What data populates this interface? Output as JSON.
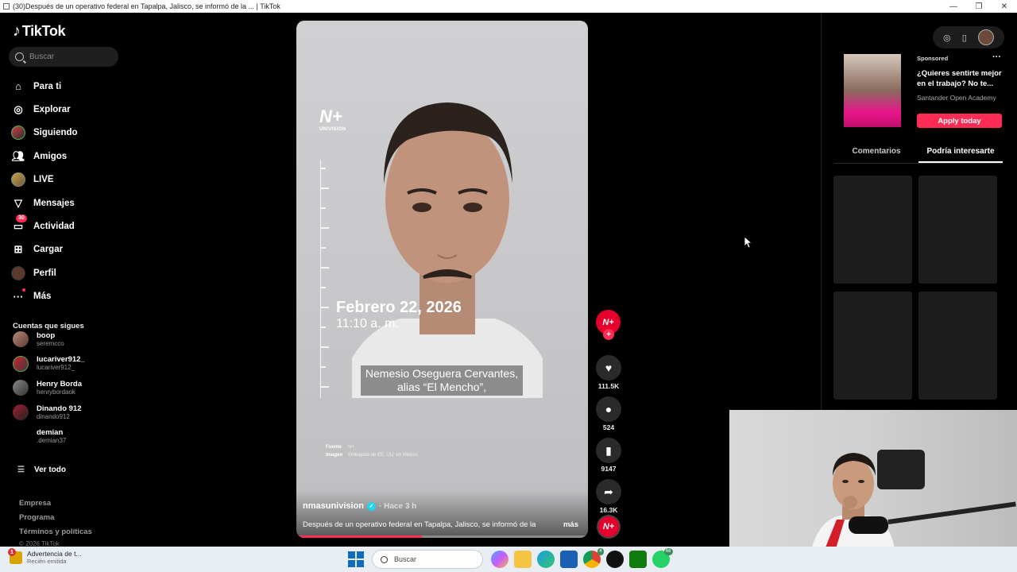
{
  "window": {
    "title": "(30)Después de un operativo federal en Tapalpa, Jalisco, se informó de la ... | TikTok"
  },
  "sidebar": {
    "brand": "TikTok",
    "search_placeholder": "Buscar",
    "nav": [
      {
        "label": "Para ti",
        "icon": "home-icon"
      },
      {
        "label": "Explorar",
        "icon": "compass-icon"
      },
      {
        "label": "Siguiendo",
        "icon": "avatar"
      },
      {
        "label": "Amigos",
        "icon": "friends-icon"
      },
      {
        "label": "LIVE",
        "icon": "avatar"
      },
      {
        "label": "Mensajes",
        "icon": "send-icon"
      },
      {
        "label": "Actividad",
        "icon": "inbox-icon",
        "badge": "30"
      },
      {
        "label": "Cargar",
        "icon": "upload-icon"
      },
      {
        "label": "Perfil",
        "icon": "avatar"
      },
      {
        "label": "Más",
        "icon": "more-icon"
      }
    ],
    "following_title": "Cuentas que sigues",
    "following": [
      {
        "name": "boop",
        "user": "seremcco"
      },
      {
        "name": "lucariver912_",
        "user": "lucariver912_"
      },
      {
        "name": "Henry Borda",
        "user": "henrybordaok"
      },
      {
        "name": "Dinando 912",
        "user": "dinando912"
      },
      {
        "name": "demian",
        "user": ".demian37"
      }
    ],
    "see_all": "Ver todo",
    "footer": [
      "Empresa",
      "Programa",
      "Términos y políticas"
    ],
    "copyright": "© 2026 TikTok"
  },
  "video": {
    "brand_big": "N+",
    "brand_small": "UNIVISION",
    "date_line1": "Febrero 22, 2026",
    "date_line2": "11:10 a. m.",
    "caption_line1": "Nemesio Oseguera Cervantes,",
    "caption_line2": "alias “El Mencho”,",
    "source_label": "Fuente",
    "source_value": "N+",
    "image_label": "Imagen",
    "image_value": "Embajada de EE. UU. en México",
    "author": "nmasunivision",
    "time_ago": "· Hace 3 h",
    "description": "Después de un operativo federal en Tapalpa, Jalisco, se informó de la",
    "more": "más",
    "progress": 0.43
  },
  "actions": {
    "avatar_text": "N+",
    "likes": "111.5K",
    "comments": "524",
    "saves": "9147",
    "shares": "16.3K"
  },
  "right_panel": {
    "ad": {
      "sponsored": "Sponsored",
      "title": "¿Quieres sentirte mejor en el trabajo? No te...",
      "brand": "Santander Open Academy",
      "cta": "Apply today"
    },
    "tabs": [
      "Comentarios",
      "Podría interesarte"
    ],
    "active_tab": 1
  },
  "taskbar": {
    "notif_title": "Advertencia de t...",
    "notif_sub": "Recién emitida",
    "notif_count": "1",
    "search_placeholder": "Buscar",
    "badge_a": "4",
    "badge_b": "66"
  },
  "colors": {
    "accent": "#fe2c55",
    "verified": "#20d5ec",
    "brand_red": "#e4002b"
  }
}
